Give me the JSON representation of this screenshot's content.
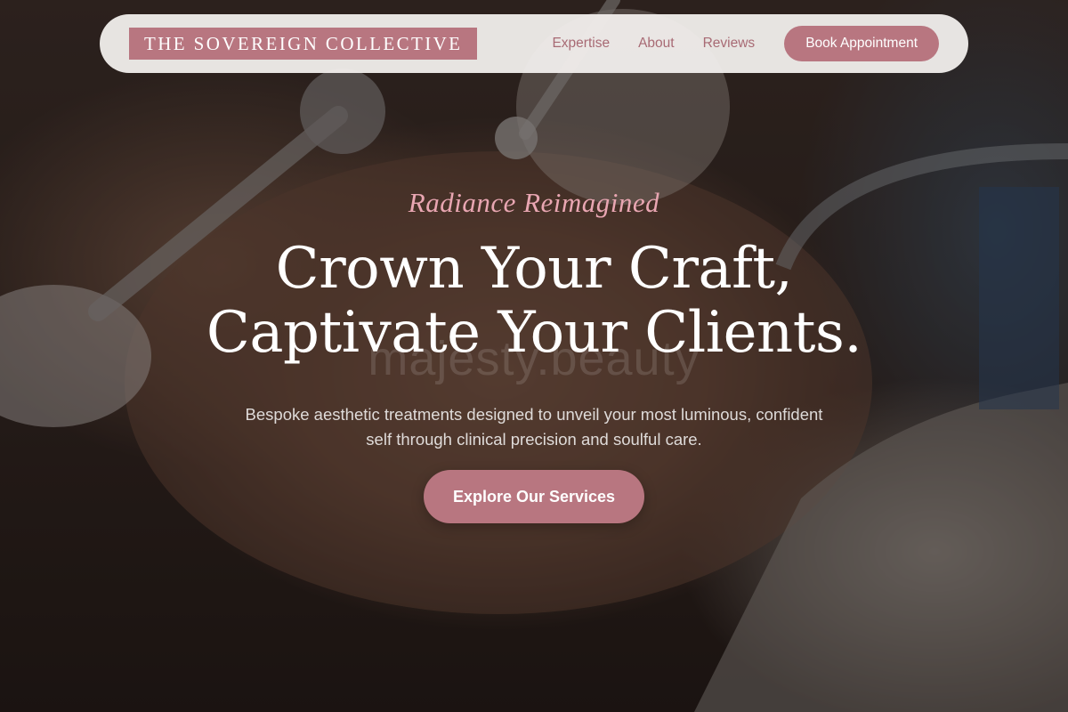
{
  "header": {
    "brand": "THE SOVEREIGN COLLECTIVE",
    "nav": [
      {
        "label": "Expertise"
      },
      {
        "label": "About"
      },
      {
        "label": "Reviews"
      }
    ],
    "cta_label": "Book Appointment"
  },
  "hero": {
    "eyebrow": "Radiance Reimagined",
    "headline_line1": "Crown Your Craft,",
    "headline_line2": "Captivate Your Clients.",
    "subtitle": "Bespoke aesthetic treatments designed to unveil your most luminous, confident self through clinical precision and soulful care.",
    "cta_label": "Explore Our Services",
    "watermark": "majesty.beauty"
  },
  "colors": {
    "accent": "#b87680",
    "accent_text": "#a86a74",
    "eyebrow": "#e9a6b2",
    "nav_bg": "#f3f0ee",
    "headline": "#ffffff"
  }
}
